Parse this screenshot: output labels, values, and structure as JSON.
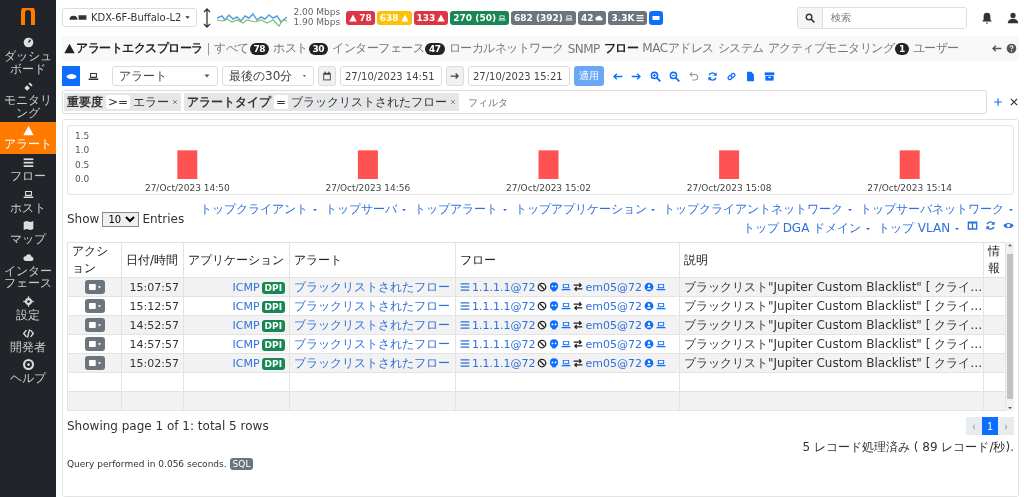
{
  "sidebar": {
    "items": [
      {
        "label": "ダッシュボード",
        "selected": false
      },
      {
        "label": "モニタリング",
        "selected": false
      },
      {
        "label": "アラート",
        "selected": true
      },
      {
        "label": "フロー",
        "selected": false
      },
      {
        "label": "ホスト",
        "selected": false
      },
      {
        "label": "マップ",
        "selected": false
      },
      {
        "label": "インターフェース",
        "selected": false
      },
      {
        "label": "設定",
        "selected": false
      },
      {
        "label": "開発者",
        "selected": false
      },
      {
        "label": "ヘルプ",
        "selected": false
      }
    ]
  },
  "topbar": {
    "interface": "KDX-6F-Buffalo-L2",
    "upload": "2.00 Mbps",
    "download": "1.90 Mbps",
    "badges": [
      {
        "text": "78",
        "color": "#dc3545"
      },
      {
        "text": "638",
        "color": "#ffc107"
      },
      {
        "text": "133",
        "color": "#dc3545"
      },
      {
        "text": "270 (50)",
        "color": "#198754"
      },
      {
        "text": "682 (392)",
        "color": "#6c757d"
      },
      {
        "text": "42",
        "color": "#6c757d"
      },
      {
        "text": "3.3K",
        "color": "#6c757d"
      },
      {
        "color": "#0d6efd"
      }
    ],
    "search": {
      "placeholder": "検索"
    }
  },
  "nav": {
    "title": "アラートエクスプローラ",
    "separator": "|",
    "tabs": [
      {
        "label": "すべて",
        "count": "78",
        "selected": false
      },
      {
        "label": "ホスト",
        "count": "30",
        "selected": false
      },
      {
        "label": "インターフェース",
        "count": "47",
        "selected": false
      },
      {
        "label": "ローカルネットワーク",
        "selected": false
      },
      {
        "label": "SNMP",
        "selected": false
      },
      {
        "label": "フロー",
        "selected": true
      },
      {
        "label": "MACアドレス",
        "selected": false
      },
      {
        "label": "システム",
        "selected": false
      },
      {
        "label": "アクティブモニタリング",
        "count": "1",
        "selected": false
      },
      {
        "label": "ユーザー",
        "selected": false
      }
    ]
  },
  "toolbar": {
    "views": [
      {
        "selected": true
      },
      {
        "selected": false
      }
    ],
    "alert_type": "アラート",
    "period": "最後の30分",
    "start": "27/10/2023 14:51",
    "end": "27/10/2023 15:21",
    "apply": "適用"
  },
  "filters": {
    "items": [
      {
        "field": "重要度",
        "operator": ">=",
        "value": "エラー"
      },
      {
        "field": "アラートタイプ",
        "operator": "=",
        "value": "ブラックリストされたフロー"
      }
    ],
    "placeholder": "フィルタ"
  },
  "chart": {
    "chart_data": {
      "type": "bar",
      "categories": [
        "27/Oct/2023 14:50",
        "27/Oct/2023 14:56",
        "27/Oct/2023 15:02",
        "27/Oct/2023 15:08",
        "27/Oct/2023 15:14"
      ],
      "ylim": [
        0,
        1.5
      ],
      "yticks": [
        {
          "value": 0,
          "label": "0.0"
        },
        {
          "value": 0.5,
          "label": "0.5"
        },
        {
          "value": 1,
          "label": "1.0"
        },
        {
          "value": 1.5,
          "label": "1.5"
        }
      ],
      "series": [
        {
          "color": "#ff5252",
          "values": [
            1,
            1,
            1,
            1,
            1
          ]
        }
      ]
    }
  },
  "table": {
    "show": "Show",
    "page_size": "10",
    "entries": "Entries",
    "menus": [
      "トップクライアント",
      "トップサーバ",
      "トップアラート",
      "トップアプリケーション",
      "トップクライアントネットワーク",
      "トップサーバネットワーク",
      "トップ DGA ドメイン",
      "トップ VLAN"
    ],
    "columns": [
      "アクション",
      "日付/時間",
      "アプリケーション",
      "アラート",
      "フロー",
      "説明",
      "情報"
    ],
    "rows": [
      {
        "time": "15:07:57",
        "application": "ICMP",
        "tag": "DPI",
        "alert": "ブラックリストされたフロー",
        "client": "1.1.1.1@72",
        "server": "em05@72",
        "description": "ブラックリスト\"Jupiter Custom Blacklist\" [ クライ…"
      },
      {
        "time": "15:12:57",
        "application": "ICMP",
        "tag": "DPI",
        "alert": "ブラックリストされたフロー",
        "client": "1.1.1.1@72",
        "server": "em05@72",
        "description": "ブラックリスト\"Jupiter Custom Blacklist\" [ クライ…"
      },
      {
        "time": "14:52:57",
        "application": "ICMP",
        "tag": "DPI",
        "alert": "ブラックリストされたフロー",
        "client": "1.1.1.1@72",
        "server": "em05@72",
        "description": "ブラックリスト\"Jupiter Custom Blacklist\" [ クライ…"
      },
      {
        "time": "14:57:57",
        "application": "ICMP",
        "tag": "DPI",
        "alert": "ブラックリストされたフロー",
        "client": "1.1.1.1@72",
        "server": "em05@72",
        "description": "ブラックリスト\"Jupiter Custom Blacklist\" [ クライ…"
      },
      {
        "time": "15:02:57",
        "application": "ICMP",
        "tag": "DPI",
        "alert": "ブラックリストされたフロー",
        "client": "1.1.1.1@72",
        "server": "em05@72",
        "description": "ブラックリスト\"Jupiter Custom Blacklist\" [ クライ…"
      }
    ],
    "summary": "Showing page 1 of 1: total 5 rows",
    "pages": [
      {
        "label": "1",
        "selected": true
      }
    ],
    "prev": "‹",
    "next": "›",
    "stats": "5 レコード処理済み ( 89 レコード/秒).",
    "query": "Query performed in 0.056 seconds.",
    "query_tag": "SQL"
  }
}
